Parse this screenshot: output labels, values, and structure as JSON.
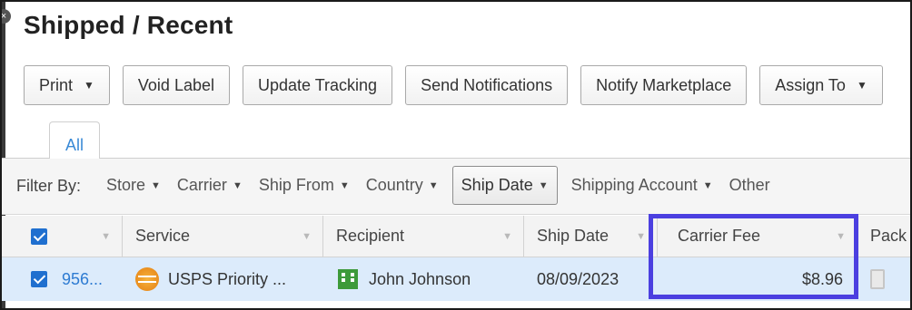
{
  "page": {
    "title": "Shipped / Recent"
  },
  "toolbar": {
    "buttons": [
      {
        "label": "Print",
        "has_caret": true
      },
      {
        "label": "Void Label"
      },
      {
        "label": "Update Tracking"
      },
      {
        "label": "Send Notifications"
      },
      {
        "label": "Notify Marketplace"
      },
      {
        "label": "Assign To",
        "has_caret": true
      }
    ]
  },
  "tabs": [
    {
      "label": "All",
      "active": true
    }
  ],
  "filters": {
    "label": "Filter By:",
    "items": [
      {
        "label": "Store"
      },
      {
        "label": "Carrier"
      },
      {
        "label": "Ship From"
      },
      {
        "label": "Country"
      },
      {
        "label": "Ship Date",
        "active": true
      },
      {
        "label": "Shipping Account"
      },
      {
        "label": "Other"
      }
    ]
  },
  "table": {
    "columns": [
      {
        "label": ""
      },
      {
        "label": "Service"
      },
      {
        "label": "Recipient"
      },
      {
        "label": "Ship Date"
      },
      {
        "label": "Carrier Fee"
      },
      {
        "label": "Pack"
      }
    ],
    "rows": [
      {
        "selected": true,
        "order": "956...",
        "service": "USPS Priority ...",
        "recipient": "John Johnson",
        "ship_date": "08/09/2023",
        "carrier_fee": "$8.96"
      }
    ]
  },
  "icons": {
    "service": "usps-logo-icon",
    "recipient": "building-icon",
    "package": "package-icon",
    "caret": "caret-down-icon"
  },
  "colors": {
    "accent_link": "#2d7bd2",
    "checkbox": "#1f6fcf",
    "selected_row": "#dcebfb",
    "highlight_box": "#4b3fe0",
    "recipient_icon": "#3d9a3a",
    "service_icon": "#f0961f"
  }
}
